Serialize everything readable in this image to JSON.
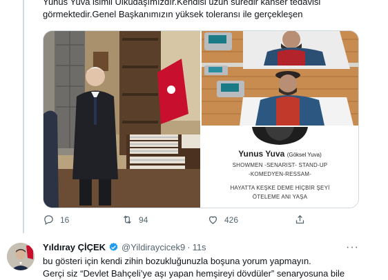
{
  "tweet": {
    "text_lines": [
      "Yunus Yuva isimli Ülküdaşımızdır.Kendisi uzun süredir kanser tedavisi",
      "görmektedir.Genel Başkanımızın yüksek toleransı ile gerçekleşen"
    ],
    "card": {
      "name": "Yunus Yuva",
      "alias": "(Göksel Yuva)",
      "line1": "SHOWMEN -SENARIST- STAND-UP",
      "line2": "-KOMEDYEN-RESSAM-",
      "line3": "HAYATTA KEŞKE DEME HİÇBİR ŞEYİ",
      "line4": "ÖTELEME ANI YAŞA"
    },
    "actions": {
      "replies": "16",
      "retweets": "94",
      "likes": "426"
    }
  },
  "reply": {
    "name": "Yıldıray ÇİÇEK",
    "handle": "@Yildiraycicek9",
    "separator": "·",
    "time": "11s",
    "more": "···",
    "text_lines": [
      "bu gösteri için kendi zihin bozukluğunuzla boşuna yorum yapmayın.",
      "Gerçi siz “Devlet Bahçeli’ye aşı yapan hemşireyi dövdüler” senaryosuna bile"
    ]
  },
  "colors": {
    "text": "#0f1419",
    "secondary": "#536471",
    "border": "#cfd9de",
    "verified": "#1d9bf0"
  }
}
